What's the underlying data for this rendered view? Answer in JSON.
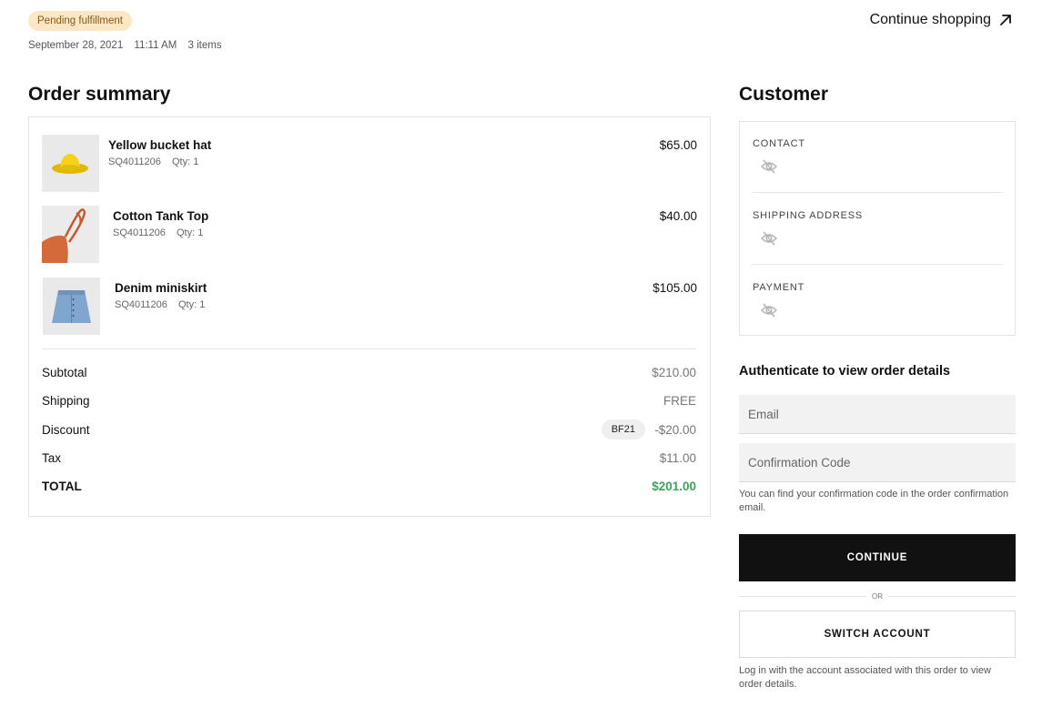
{
  "header": {
    "status_badge": "Pending fulfillment",
    "date": "September 28, 2021",
    "time": "11:11 AM",
    "item_count": "3 items",
    "continue_shopping": "Continue shopping"
  },
  "order_summary": {
    "title": "Order summary",
    "items": [
      {
        "name": "Yellow bucket hat",
        "sku": "SQ4011206",
        "qty": "Qty: 1",
        "price": "$65.00"
      },
      {
        "name": "Cotton Tank Top",
        "sku": "SQ4011206",
        "qty": "Qty: 1",
        "price": "$40.00"
      },
      {
        "name": "Denim miniskirt",
        "sku": "SQ4011206",
        "qty": "Qty: 1",
        "price": "$105.00"
      }
    ],
    "subtotal_label": "Subtotal",
    "subtotal_value": "$210.00",
    "shipping_label": "Shipping",
    "shipping_value": "FREE",
    "discount_label": "Discount",
    "discount_code": "BF21",
    "discount_value": "-$20.00",
    "tax_label": "Tax",
    "tax_value": "$11.00",
    "total_label": "TOTAL",
    "total_value": "$201.00"
  },
  "customer": {
    "title": "Customer",
    "contact_label": "CONTACT",
    "shipping_label": "SHIPPING ADDRESS",
    "payment_label": "PAYMENT"
  },
  "auth": {
    "title": "Authenticate to view order details",
    "email_placeholder": "Email",
    "code_placeholder": "Confirmation Code",
    "code_hint": "You can find your confirmation code in the order confirmation email.",
    "continue_label": "CONTINUE",
    "or_label": "OR",
    "switch_label": "SWITCH ACCOUNT",
    "switch_hint": "Log in with the account associated with this order to view order details."
  },
  "colors": {
    "badge_bg": "#fbe6c6",
    "badge_text": "#8a5a14",
    "total_green": "#3aa55c",
    "button_black": "#111111"
  },
  "icons": {
    "continue_shopping": "arrow-up-right-icon",
    "hidden": "eye-off-icon"
  }
}
